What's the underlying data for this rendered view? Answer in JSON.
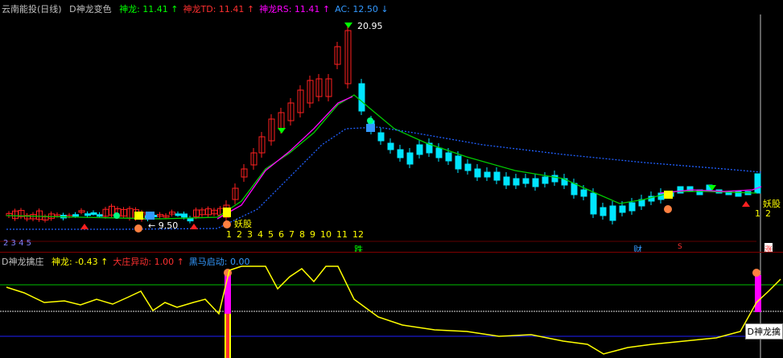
{
  "main": {
    "stock_title": "云南能投(日线)",
    "indicator_name": "D神龙变色",
    "items": [
      {
        "label": "神龙: 11.41",
        "arrow": "↑",
        "color": "#00ff00"
      },
      {
        "label": "神龙TD: 11.41",
        "arrow": "↑",
        "color": "#ff3030"
      },
      {
        "label": "神龙RS: 11.41",
        "arrow": "↑",
        "color": "#ff00ff"
      },
      {
        "label": "AC: 12.50",
        "arrow": "↓",
        "color": "#3399ff"
      }
    ],
    "peak_label": "20.95",
    "low_label": "← 9.50",
    "yao_label_left": "妖股",
    "yao_label_right": "妖股",
    "count_left": [
      "1",
      "2",
      "3",
      "4",
      "5",
      "6",
      "7",
      "8",
      "9",
      "10",
      "11",
      "12"
    ],
    "count_right": [
      "1",
      "2"
    ],
    "count_faded": "2 3 4 5",
    "tag_die": "跌",
    "tag_cai": "财",
    "tag_s": "S",
    "tag_zhang": "涨"
  },
  "sub": {
    "indicator_name": "D神龙擒庄",
    "items": [
      {
        "label": "神龙: -0.43",
        "arrow": "↑",
        "color": "#ffff00"
      },
      {
        "label": "大庄异动: 1.00",
        "arrow": "↑",
        "color": "#ff3030"
      },
      {
        "label": "黑马启动: 0.00",
        "arrow": "",
        "color": "#3399ff"
      }
    ],
    "tooltip": "D神龙擒"
  },
  "colors": {
    "up": "#ff2020",
    "down": "#00e5ff",
    "ma_green": "#00cc00",
    "ma_magenta": "#ff00ff",
    "ma_blue_dotted": "#2060ff",
    "signal_yellow": "#ffff00"
  }
}
